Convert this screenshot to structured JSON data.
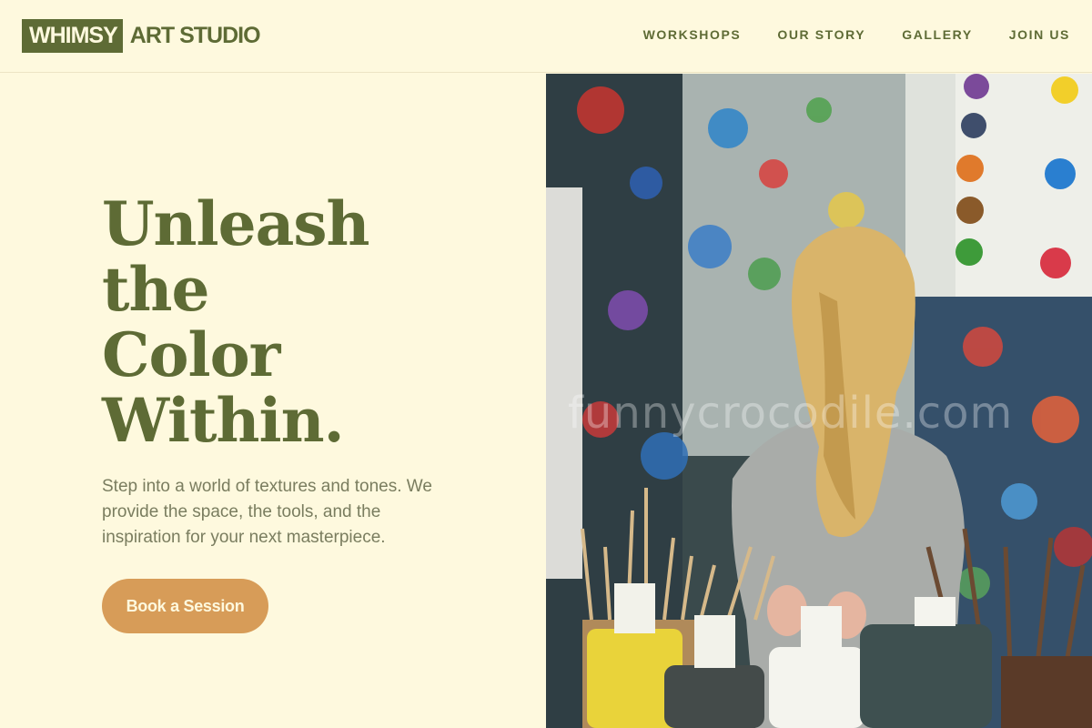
{
  "brand": {
    "box_text": "WHIMSY",
    "rest_text": "ART STUDIO"
  },
  "nav": {
    "items": [
      {
        "label": "WORKSHOPS"
      },
      {
        "label": "OUR STORY"
      },
      {
        "label": "GALLERY"
      },
      {
        "label": "JOIN US"
      }
    ]
  },
  "hero": {
    "title_lines": [
      "Unleash",
      "the",
      "Color",
      "Within."
    ],
    "subtitle": "Step into a world of textures and tones. We provide the space, the tools, and the inspiration for your next masterpiece.",
    "cta_label": "Book a Session"
  },
  "photo": {
    "watermark": "funnycrocodile.com"
  },
  "colors": {
    "background": "#fef9de",
    "brand_green": "#5e6b35",
    "accent_orange": "#d79c58",
    "body_text": "#7a7d5f"
  }
}
